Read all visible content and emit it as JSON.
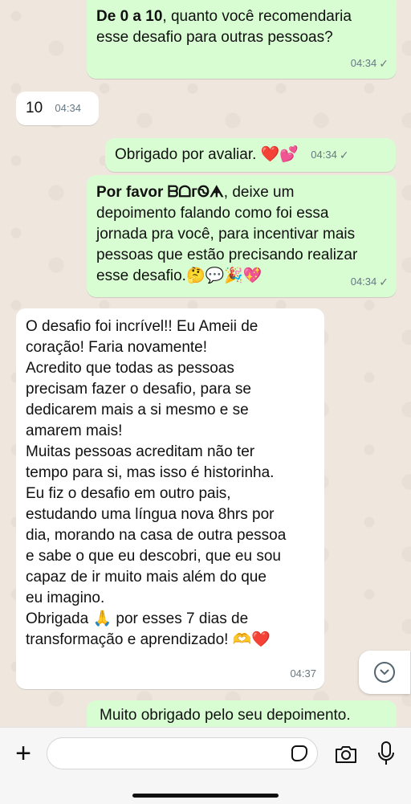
{
  "messages": [
    {
      "lines_bold": "De 0 a 10",
      "text": ", quanto você recomendaria\nesse desafio para outras pessoas?",
      "time": "04:34"
    },
    {
      "text": "10",
      "time": "04:34"
    },
    {
      "text": "Obrigado por avaliar. ❤️💕",
      "time": "04:34"
    },
    {
      "bold": "Por favor ᗷᗝᴦᏫᗗ",
      "text": ", deixe um\ndepoimento falando como foi essa\njornada pra você, para incentivar mais\npessoas que estão precisando realizar\nesse desafio.🤔💬🎉💖",
      "time": "04:34"
    },
    {
      "text": "O desafio foi incrível!! Eu Ameii de\ncoração! Faria novamente!\nAcredito que todas as pessoas\nprecisam fazer o desafio, para se\ndedicarem mais a si mesmo e se\namarem mais!\nMuitas pessoas acreditam não ter\ntempo para si, mas isso é historinha.\nEu fiz o desafio em outro pais,\nestudando uma língua nova 8hrs por\ndia, morando na casa de outra pessoa\ne sabe o que eu descobri, que eu sou\ncapaz de ir muito mais além do que\neu imagino.\nObrigada 🙏 por esses 7 dias de\ntransformação e aprendizado! 🫶❤️",
      "time": "04:37"
    },
    {
      "text": "Muito obrigado pelo seu depoimento."
    }
  ],
  "icons": {
    "read_receipt": "✓",
    "scroll_down": "chevron-down-icon",
    "plus": "+"
  },
  "input": {
    "placeholder": ""
  }
}
